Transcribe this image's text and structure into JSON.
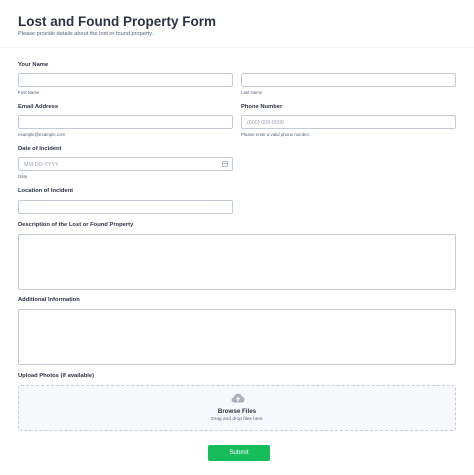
{
  "form": {
    "title": "Lost and Found Property Form",
    "subtitle": "Please provide details about the lost or found property."
  },
  "name": {
    "label": "Your Name",
    "first_sublabel": "First Name",
    "last_sublabel": "Last Name",
    "first_value": "",
    "last_value": ""
  },
  "email": {
    "label": "Email Address",
    "sublabel": "example@example.com",
    "value": ""
  },
  "phone": {
    "label": "Phone Number",
    "placeholder": "(000) 000-0000",
    "sublabel": "Please enter a valid phone number."
  },
  "date": {
    "label": "Date of Incident",
    "placeholder": "MM-DD-YYYY",
    "sublabel": "Date"
  },
  "location": {
    "label": "Location of Incident",
    "value": ""
  },
  "description": {
    "label": "Description of the Lost or Found Property",
    "value": ""
  },
  "additional": {
    "label": "Additional Information",
    "value": ""
  },
  "upload": {
    "label": "Upload Photos (if available)",
    "browse": "Browse Files",
    "drag": "Drag and drop files here",
    "icon": "cloud-upload-icon"
  },
  "submit": {
    "label": "Submit"
  },
  "colors": {
    "accent": "#18bd5b",
    "text": "#2c3345",
    "border": "#c3cad8"
  }
}
